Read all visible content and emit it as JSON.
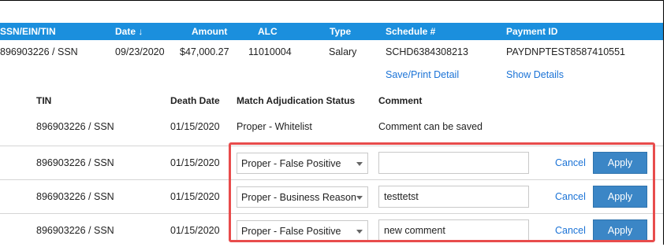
{
  "header": {
    "ssn": "SSN/EIN/TIN",
    "date": "Date",
    "date_sort_icon": "↓",
    "amount": "Amount",
    "alc": "ALC",
    "type": "Type",
    "schedule": "Schedule #",
    "payment_id": "Payment ID"
  },
  "record": {
    "ssn": "896903226 / SSN",
    "date": "09/23/2020",
    "amount": "$47,000.27",
    "alc": "11010004",
    "type": "Salary",
    "schedule": "SCHD6384308213",
    "payment_id": "PAYDNPTEST8587410551",
    "save_print_label": "Save/Print Detail",
    "show_details_label": "Show Details"
  },
  "sub_header": {
    "tin": "TIN",
    "death_date": "Death Date",
    "status": "Match Adjudication Status",
    "comment": "Comment"
  },
  "match_rows": [
    {
      "tin": "896903226 / SSN",
      "death_date": "01/15/2020",
      "status": "Proper - Whitelist",
      "comment": "Comment can be saved"
    },
    {
      "tin": "896903226 / SSN",
      "death_date": "01/15/2020",
      "status": "Proper - False Positive",
      "comment": "",
      "cancel": "Cancel",
      "apply": "Apply"
    },
    {
      "tin": "896903226 / SSN",
      "death_date": "01/15/2020",
      "status": "Proper - Business Reason",
      "comment": "testtetst",
      "cancel": "Cancel",
      "apply": "Apply"
    },
    {
      "tin": "896903226 / SSN",
      "death_date": "01/15/2020",
      "status": "Proper - False Positive",
      "comment": "new comment",
      "cancel": "Cancel",
      "apply": "Apply"
    }
  ],
  "colors": {
    "header_bg": "#1b8fdd",
    "link": "#1b73d6",
    "apply_bg": "#3b86c6",
    "highlight_border": "#e84c4c"
  }
}
